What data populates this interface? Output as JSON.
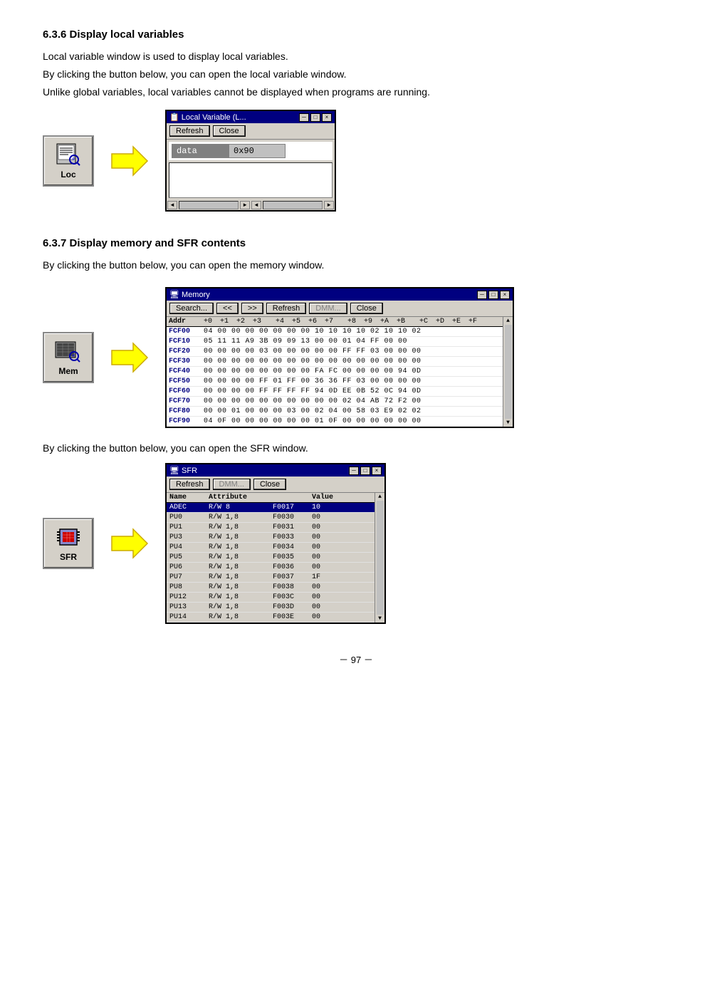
{
  "sections": [
    {
      "id": "section-6-3-6",
      "heading": "6.3.6 Display local variables",
      "paragraphs": [
        "Local variable window is used to display local variables.",
        "By clicking the button below, you can open the local variable window.",
        "Unlike global variables, local variables cannot be displayed when programs are running."
      ],
      "icon_label": "Loc",
      "window": {
        "title": "Local Variable (L...",
        "buttons": [
          "Refresh",
          "Close"
        ],
        "data_row": [
          "data",
          "0x90"
        ],
        "title_controls": [
          "-",
          "□",
          "×"
        ]
      }
    },
    {
      "id": "section-6-3-7",
      "heading": "6.3.7 Display memory and SFR contents",
      "paragraphs_mem": [
        "By clicking the button below, you can open the memory window."
      ],
      "paragraphs_sfr": [
        "By clicking the button below, you can open the SFR window."
      ],
      "memory_icon_label": "Mem",
      "sfr_icon_label": "SFR",
      "memory_window": {
        "title": "Memory",
        "toolbar": [
          "Search...",
          "<<",
          ">>",
          "Refresh",
          "DMM...",
          "Close"
        ],
        "header": "Addr  +0  +1  +2  +3    +4  +5  +6  +7    +8  +9  +A  +B    +C  +D  +E  +F",
        "rows": [
          {
            "addr": "FCF00",
            "bytes": "04 00 00 00   00 00 00 00   10 10 10 10   02 10 10 02"
          },
          {
            "addr": "FCF10",
            "bytes": "05 11 11      A9 3B 09 09   13 00 00 01   04 FF 00 00"
          },
          {
            "addr": "FCF20",
            "bytes": "00 00 00 00   03 00 00 00   00 00 FF FF   03 00 00 00"
          },
          {
            "addr": "FCF30",
            "bytes": "00 00 00 00   00 00 00 00   00 00 00 00   00 00 00 00"
          },
          {
            "addr": "FCF40",
            "bytes": "00 00 00 00   00 00 00 00   FA FC 00 00   00 00 94 0D"
          },
          {
            "addr": "FCF50",
            "bytes": "00 00 00 00   FF 01 FF 00   36 36 FF 03   00 00 00 00"
          },
          {
            "addr": "FCF60",
            "bytes": "00 00 00 00   FF FF FF FF   94 0D EE 0B   52 0C 94 0D"
          },
          {
            "addr": "FCF70",
            "bytes": "00 00 00 00   00 00 00 00   00 00 02 04   AB 72 F2 00"
          },
          {
            "addr": "FCF80",
            "bytes": "00 00 01 00   00 00 03 00   02 04 00 58   03 E9 02 02"
          },
          {
            "addr": "FCF90",
            "bytes": "04 0F 00 00   00 00 00 00   01 0F 00 00   00 00 00 00"
          }
        ],
        "title_controls": [
          "-",
          "□",
          "×"
        ]
      },
      "sfr_window": {
        "title": "SFR",
        "toolbar": [
          "Refresh",
          "DMM...",
          "Close"
        ],
        "columns": [
          "Name",
          "Attribute",
          "",
          "Value"
        ],
        "rows": [
          {
            "name": "ADEC",
            "attr": "R/W  8",
            "addr": "F0017",
            "val": "10",
            "selected": true
          },
          {
            "name": "PU0",
            "attr": "R/W  1,8",
            "addr": "F0030",
            "val": "00"
          },
          {
            "name": "PU1",
            "attr": "R/W  1,8",
            "addr": "F0031",
            "val": "00"
          },
          {
            "name": "PU3",
            "attr": "R/W  1,8",
            "addr": "F0033",
            "val": "00"
          },
          {
            "name": "PU4",
            "attr": "R/W  1,8",
            "addr": "F0034",
            "val": "00"
          },
          {
            "name": "PU5",
            "attr": "R/W  1,8",
            "addr": "F0035",
            "val": "00"
          },
          {
            "name": "PU6",
            "attr": "R/W  1,8",
            "addr": "F0036",
            "val": "00"
          },
          {
            "name": "PU7",
            "attr": "R/W  1,8",
            "addr": "F0037",
            "val": "1F"
          },
          {
            "name": "PU8",
            "attr": "R/W  1,8",
            "addr": "F0038",
            "val": "00"
          },
          {
            "name": "PU12",
            "attr": "R/W  1,8",
            "addr": "F003C",
            "val": "00"
          },
          {
            "name": "PU13",
            "attr": "R/W  1,8",
            "addr": "F003D",
            "val": "00"
          },
          {
            "name": "PU14",
            "attr": "R/W  1,8",
            "addr": "F003E",
            "val": "00"
          }
        ],
        "title_controls": [
          "-",
          "□",
          "×"
        ]
      }
    }
  ],
  "page_number": "－ 97 －",
  "labels": {
    "refresh": "Refresh",
    "close": "Close",
    "search": "Search...",
    "dmm": "DMM...",
    "back": "<<",
    "forward": ">>"
  },
  "icons": {
    "minimize": "─",
    "maximize": "□",
    "close": "×",
    "scroll_up": "▲",
    "scroll_down": "▼",
    "scroll_left": "◄",
    "scroll_right": "►"
  }
}
